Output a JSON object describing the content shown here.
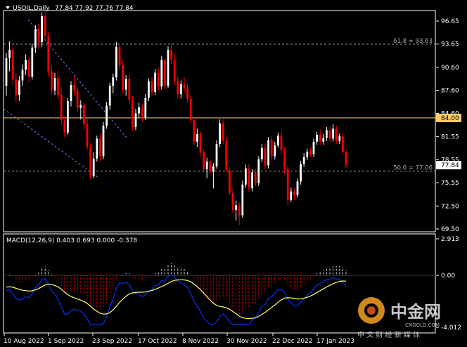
{
  "header": {
    "symbol": "USOIL,Daily",
    "ohlc": "77.84 77.92 77.76 77.84"
  },
  "macd": {
    "title": "MACD(12,26,9) 0.403 0.693 0.000 -0.378",
    "ticks": [
      "2.913",
      "0.00",
      "-4.012"
    ]
  },
  "watermark": {
    "brand": "中金网",
    "sub": "中 文 财 经 新 媒 体",
    "domain": "CNGOLD.COM"
  },
  "colors": {
    "up": "#ffffff",
    "down": "#ff0000",
    "frame": "#ffffff",
    "level_line": "#ffcc66",
    "trend_line": "#9966ff",
    "macd_signal": "#ffff66",
    "macd_line": "#0033ff"
  },
  "chart_data": [
    {
      "type": "candlestick",
      "yticks": [
        69.5,
        72.5,
        75.55,
        78.55,
        81.55,
        84.6,
        87.6,
        90.6,
        93.65,
        96.65
      ],
      "ytick_labels": [
        "69.50",
        "72.50",
        "75.55",
        "78.55",
        "81.55",
        "84.60",
        "87.60",
        "90.60",
        "93.65",
        "96.65"
      ],
      "xtick_labels": [
        "10 Aug 2022",
        "1 Sep 2022",
        "23 Sep 2022",
        "17 Oct 2022",
        "8 Nov 2022",
        "30 Nov 2022",
        "22 Dec 2022",
        "17 Jan 2023"
      ],
      "current_price": 77.84,
      "levels": [
        {
          "value": 93.63,
          "label": "61.8 = 93.63",
          "style": "dashed"
        },
        {
          "value": 84.0,
          "label": "84.00",
          "style": "solid"
        },
        {
          "value": 77.06,
          "label": "50.0 = 77.06",
          "style": "dashed"
        }
      ],
      "candles": [
        [
          88.2,
          92.5,
          86.9,
          91.8
        ],
        [
          91.8,
          94.0,
          90.1,
          92.9
        ],
        [
          92.9,
          93.4,
          88.3,
          89.0
        ],
        [
          89.0,
          89.8,
          86.0,
          87.0
        ],
        [
          87.0,
          89.5,
          86.2,
          88.9
        ],
        [
          88.9,
          91.0,
          88.2,
          90.3
        ],
        [
          90.3,
          92.3,
          89.6,
          91.6
        ],
        [
          91.6,
          92.0,
          88.7,
          89.4
        ],
        [
          89.4,
          93.7,
          89.0,
          93.2
        ],
        [
          93.2,
          96.1,
          92.5,
          95.6
        ],
        [
          95.6,
          96.3,
          93.0,
          93.9
        ],
        [
          93.9,
          97.8,
          93.3,
          97.3
        ],
        [
          97.3,
          97.9,
          94.0,
          94.7
        ],
        [
          94.7,
          95.2,
          89.4,
          90.1
        ],
        [
          90.1,
          90.9,
          87.1,
          87.6
        ],
        [
          87.6,
          89.9,
          87.0,
          89.2
        ],
        [
          89.2,
          90.2,
          86.4,
          87.0
        ],
        [
          87.0,
          88.1,
          83.1,
          83.7
        ],
        [
          83.7,
          84.2,
          81.5,
          82.1
        ],
        [
          82.1,
          86.6,
          81.8,
          86.2
        ],
        [
          86.2,
          88.8,
          85.5,
          88.3
        ],
        [
          88.3,
          89.6,
          86.9,
          87.6
        ],
        [
          87.6,
          88.0,
          84.8,
          85.3
        ],
        [
          85.3,
          86.3,
          83.8,
          85.7
        ],
        [
          85.7,
          86.0,
          82.5,
          83.2
        ],
        [
          83.2,
          83.9,
          79.8,
          80.2
        ],
        [
          80.2,
          80.7,
          76.0,
          76.4
        ],
        [
          76.4,
          79.5,
          76.1,
          78.7
        ],
        [
          78.7,
          81.7,
          78.3,
          81.3
        ],
        [
          81.3,
          82.0,
          78.3,
          79.0
        ],
        [
          79.0,
          83.5,
          78.6,
          83.0
        ],
        [
          83.0,
          86.1,
          82.6,
          85.6
        ],
        [
          85.6,
          88.6,
          85.1,
          88.2
        ],
        [
          88.2,
          89.8,
          87.2,
          89.3
        ],
        [
          89.3,
          93.9,
          88.9,
          93.3
        ],
        [
          93.3,
          93.7,
          90.3,
          90.9
        ],
        [
          90.9,
          91.5,
          87.2,
          87.7
        ],
        [
          87.7,
          89.6,
          86.9,
          89.1
        ],
        [
          89.1,
          89.7,
          85.9,
          86.4
        ],
        [
          86.4,
          86.9,
          82.3,
          82.8
        ],
        [
          82.8,
          85.2,
          82.4,
          84.6
        ],
        [
          84.6,
          86.0,
          84.0,
          85.4
        ],
        [
          85.4,
          85.9,
          83.5,
          84.0
        ],
        [
          84.0,
          87.1,
          83.7,
          86.6
        ],
        [
          86.6,
          89.2,
          86.2,
          88.8
        ],
        [
          88.8,
          89.3,
          86.9,
          87.4
        ],
        [
          87.4,
          90.4,
          87.0,
          89.9
        ],
        [
          89.9,
          90.5,
          87.6,
          88.1
        ],
        [
          88.1,
          92.1,
          87.7,
          91.6
        ],
        [
          91.6,
          91.8,
          87.7,
          88.2
        ],
        [
          88.2,
          93.4,
          87.9,
          92.9
        ],
        [
          92.9,
          93.8,
          91.0,
          91.6
        ],
        [
          91.6,
          92.3,
          88.3,
          88.8
        ],
        [
          88.8,
          89.4,
          86.6,
          87.1
        ],
        [
          87.1,
          88.9,
          86.5,
          88.4
        ],
        [
          88.4,
          89.3,
          87.4,
          87.9
        ],
        [
          87.9,
          88.4,
          86.0,
          86.5
        ],
        [
          86.5,
          86.9,
          83.3,
          83.7
        ],
        [
          83.7,
          84.1,
          80.5,
          80.9
        ],
        [
          80.9,
          82.6,
          80.2,
          81.9
        ],
        [
          81.9,
          82.3,
          79.0,
          79.5
        ],
        [
          79.5,
          79.9,
          76.9,
          77.3
        ],
        [
          77.3,
          78.8,
          76.1,
          78.3
        ],
        [
          78.3,
          78.6,
          76.7,
          77.0
        ],
        [
          77.0,
          78.1,
          74.8,
          77.7
        ],
        [
          77.7,
          81.1,
          77.4,
          80.6
        ],
        [
          80.6,
          83.8,
          80.2,
          83.3
        ],
        [
          83.3,
          83.8,
          80.6,
          81.0
        ],
        [
          81.0,
          81.5,
          76.8,
          77.2
        ],
        [
          77.2,
          77.6,
          73.9,
          74.2
        ],
        [
          74.2,
          74.7,
          71.6,
          72.0
        ],
        [
          72.0,
          73.2,
          70.6,
          72.6
        ],
        [
          72.6,
          73.0,
          70.0,
          71.3
        ],
        [
          71.3,
          75.8,
          71.0,
          75.3
        ],
        [
          75.3,
          77.9,
          74.9,
          77.4
        ],
        [
          77.4,
          78.0,
          74.3,
          74.8
        ],
        [
          74.8,
          77.3,
          74.4,
          76.9
        ],
        [
          76.9,
          77.4,
          75.1,
          75.5
        ],
        [
          75.5,
          79.0,
          75.1,
          78.6
        ],
        [
          78.6,
          80.6,
          78.2,
          80.1
        ],
        [
          80.1,
          80.6,
          77.3,
          77.8
        ],
        [
          77.8,
          81.5,
          77.4,
          81.1
        ],
        [
          81.1,
          81.6,
          78.5,
          79.0
        ],
        [
          79.0,
          80.9,
          78.6,
          80.4
        ],
        [
          80.4,
          82.1,
          80.1,
          81.7
        ],
        [
          81.7,
          82.3,
          79.3,
          79.8
        ],
        [
          79.8,
          80.2,
          76.7,
          77.3
        ],
        [
          77.3,
          77.7,
          72.6,
          73.3
        ],
        [
          73.3,
          74.9,
          73.0,
          74.4
        ],
        [
          74.4,
          74.8,
          73.3,
          73.9
        ],
        [
          73.9,
          76.1,
          73.6,
          75.7
        ],
        [
          75.7,
          78.4,
          75.3,
          78.0
        ],
        [
          78.0,
          79.4,
          77.6,
          78.9
        ],
        [
          78.9,
          80.0,
          78.5,
          79.6
        ],
        [
          79.6,
          80.1,
          78.9,
          79.3
        ],
        [
          79.3,
          81.3,
          78.9,
          80.9
        ],
        [
          80.9,
          82.2,
          80.5,
          81.8
        ],
        [
          81.8,
          82.5,
          80.5,
          80.9
        ],
        [
          80.9,
          81.9,
          80.5,
          81.4
        ],
        [
          81.4,
          82.8,
          81.0,
          82.4
        ],
        [
          82.4,
          82.9,
          80.8,
          81.3
        ],
        [
          81.3,
          83.2,
          80.9,
          82.6
        ],
        [
          82.6,
          83.0,
          80.6,
          81.0
        ],
        [
          81.0,
          82.0,
          80.6,
          81.6
        ],
        [
          81.6,
          82.1,
          79.2,
          79.6
        ],
        [
          79.6,
          79.9,
          77.5,
          77.84
        ]
      ]
    },
    {
      "type": "macd",
      "title": "MACD(12,26,9)",
      "params": [
        12,
        26,
        9
      ],
      "values": {
        "macd": 0.403,
        "signal": 0.693,
        "other": 0.0,
        "histogram": -0.378
      },
      "yticks": [
        2.913,
        0.0,
        -4.012
      ],
      "ylim": [
        -4.012,
        2.913
      ]
    }
  ]
}
